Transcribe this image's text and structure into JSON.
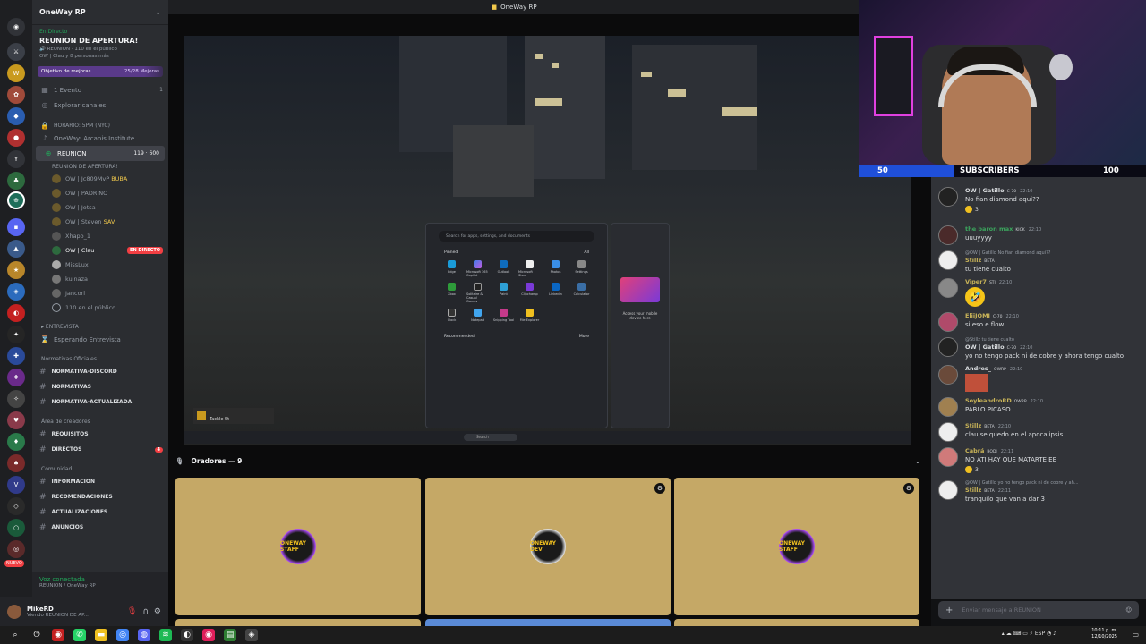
{
  "window_title": "OneWay RP",
  "server": {
    "name": "OneWay RP"
  },
  "live_event": {
    "tag": "En Directo",
    "title": "REUNION DE APERTURA!",
    "channel": "REUNION",
    "public_count": "110 en el público",
    "participants": "OW | Clau y 8 personas más"
  },
  "goal": {
    "label": "Objetivo de mejoras",
    "value": "25/28 Mejoras"
  },
  "top_channels": [
    {
      "icon": "calendar-icon",
      "label": "1 Evento",
      "count": "1"
    },
    {
      "icon": "compass-icon",
      "label": "Explorar canales",
      "count": ""
    }
  ],
  "schedule": "HORARIO: 5PM (NYC)",
  "institute": "OneWay: Arcanis Institute",
  "voice_channel": {
    "name": "REUNION",
    "meta": "119",
    "meta2": "600",
    "sub": "REUNION DE APERTURA!"
  },
  "voice_users": [
    {
      "name": "OW | Jc809MvP",
      "tag": "BUBA"
    },
    {
      "name": "OW | PADRINO",
      "tag": ""
    },
    {
      "name": "OW | Jotsa",
      "tag": ""
    },
    {
      "name": "OW | Steven",
      "tag": "SAV"
    },
    {
      "name": "Xhapo_1",
      "tag": ""
    },
    {
      "name": "OW | Clau",
      "tag": "EN DIRECTO"
    },
    {
      "name": "MissLux",
      "tag": ""
    },
    {
      "name": "kuinaza",
      "tag": ""
    },
    {
      "name": "Jancorl",
      "tag": ""
    }
  ],
  "audience_count": "110 en el público",
  "category_interview": "ENTREVISTA",
  "interview_channel": "Esperando Entrevista",
  "category_rules": "Normativas Oficiales",
  "rules_channels": [
    "NORMATIVA-DISCORD",
    "NORMATIVAS",
    "NORMATIVA-ACTUALIZADA"
  ],
  "category_creators": "Área de creadores",
  "creator_channels": [
    "REQUISITOS",
    "DIRECTOS"
  ],
  "creator_badge": "4",
  "category_community": "Comunidad",
  "community_channels": [
    "INFORMACION",
    "RECOMENDACIONES",
    "ACTUALIZACIONES",
    "ANUNCIOS"
  ],
  "voice_connected": {
    "status": "Voz conectada",
    "where": "REUNION / OneWay RP"
  },
  "user": {
    "name": "MikeRD",
    "status": "Viendo REUNION DE AP..."
  },
  "rail_new_badge": "NUEVO",
  "stage": {
    "section_title": "Oradores — 9",
    "start_search": "Search for apps, settings, and documents",
    "pinned_label": "Pinned",
    "all_label": "All",
    "recommended_label": "Recommended",
    "more_label": "More",
    "apps": [
      "Edge",
      "Microsoft 365 Copilot",
      "Outlook",
      "Microsoft Store",
      "Photos",
      "Settings",
      "Xbox",
      "Solitaire & Casual Games",
      "Paint",
      "Clipchamp",
      "LinkedIn",
      "Calculator",
      "Clock",
      "Notepad",
      "Snipping Tool",
      "File Explorer"
    ],
    "side_panel_text": "Access your mobile device here",
    "game_hud_name": "Tackle St",
    "taskbar_search": "Search",
    "tile_logos": [
      "ONEWAY STAFF",
      "ONEWAY DEV",
      "ONEWAY STAFF"
    ]
  },
  "subs_bar": {
    "start": "50",
    "label": "SUBSCRIBERS",
    "end": "100",
    "fill_fraction": 0.33
  },
  "chat": [
    {
      "name": "OW | Gatillo",
      "color": "#dbdee1",
      "badge": "C-70",
      "time": "22:10",
      "reply": "",
      "text": "No fian diamond aqui??",
      "reaction": "3"
    },
    {
      "name": "the baron max",
      "color": "#3ba55d",
      "badge": "KICK",
      "time": "22:10",
      "reply": "",
      "text": "uuuyyyy",
      "reaction": ""
    },
    {
      "name": "Stillz",
      "color": "#c9b458",
      "badge": "BETA",
      "time": "22:10",
      "reply": "@OW | Gatillo  No fian diamond aqui??",
      "text": "tu tiene cualto",
      "reaction": ""
    },
    {
      "name": "Viper7",
      "color": "#c9b458",
      "badge": "STI",
      "time": "22:10",
      "reply": "",
      "text": "🤣",
      "reaction": ""
    },
    {
      "name": "EliiJOMI",
      "color": "#c9b458",
      "badge": "C-70",
      "time": "22:10",
      "reply": "",
      "text": "si eso e flow",
      "reaction": ""
    },
    {
      "name": "OW | Gatillo",
      "color": "#dbdee1",
      "badge": "C-70",
      "time": "22:10",
      "reply": "@Stillz  tu tiene cualto",
      "text": "yo no tengo pack ni de cobre y ahora tengo cualto",
      "reaction": ""
    },
    {
      "name": "Andres_",
      "color": "#dbdee1",
      "badge": "OWRP",
      "time": "22:10",
      "reply": "",
      "text": "",
      "reaction": ""
    },
    {
      "name": "SoyleandroRD",
      "color": "#c9b458",
      "badge": "OWRP",
      "time": "22:10",
      "reply": "",
      "text": "PABLO PICASO",
      "reaction": ""
    },
    {
      "name": "Stillz",
      "color": "#c9b458",
      "badge": "BETA",
      "time": "22:10",
      "reply": "",
      "text": "clau se quedo en el apocalipsis",
      "reaction": ""
    },
    {
      "name": "Cabrá",
      "color": "#c9b458",
      "badge": "BODI",
      "time": "22:11",
      "reply": "",
      "text": "NO ATI HAY QUE MATARTE EE",
      "reaction": "3"
    },
    {
      "name": "Stillz",
      "color": "#c9b458",
      "badge": "BETA",
      "time": "22:11",
      "reply": "@OW | Gatillo  yo no tengo pack ni de cobre y ah...",
      "text": "tranquilo que van a dar 3",
      "reaction": ""
    }
  ],
  "chat_input_placeholder": "Enviar mensaje a  REUNION",
  "clock": {
    "time": "10:11 p. m.",
    "date": "12/10/2025"
  },
  "tray_lang": "ESP"
}
